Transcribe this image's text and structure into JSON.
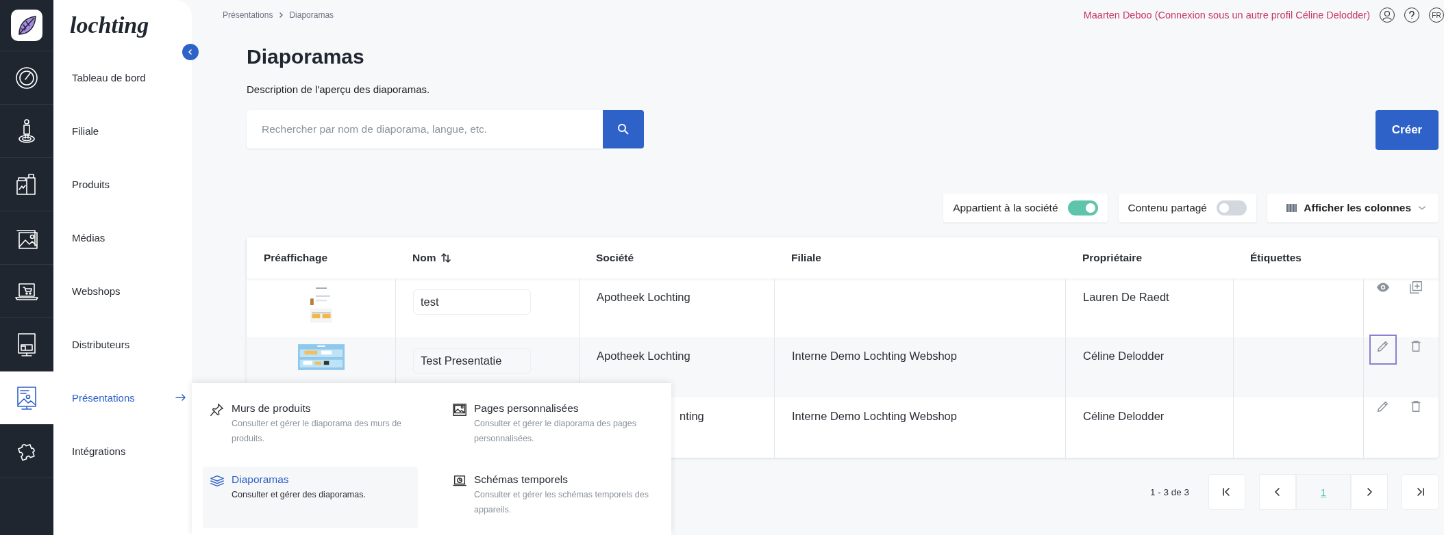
{
  "brand": {
    "wordmark": "lochting"
  },
  "sidebar": {
    "items": [
      {
        "label": "Tableau de bord",
        "selected": false
      },
      {
        "label": "Filiale",
        "selected": false
      },
      {
        "label": "Produits",
        "selected": false
      },
      {
        "label": "Médias",
        "selected": false
      },
      {
        "label": "Webshops",
        "selected": false
      },
      {
        "label": "Distributeurs",
        "selected": false
      },
      {
        "label": "Présentations",
        "selected": true
      },
      {
        "label": "Intégrations",
        "selected": false
      }
    ]
  },
  "breadcrumb": [
    "Présentations",
    "Diaporamas"
  ],
  "user": {
    "name": "Maarten Deboo (Connexion sous un autre profil Céline Delodder)",
    "language": "FR"
  },
  "page": {
    "title": "Diaporamas",
    "description": "Description de l'aperçu des diaporamas."
  },
  "search": {
    "placeholder": "Rechercher par nom de diaporama, langue, etc."
  },
  "create_button": "Créer",
  "filters": [
    {
      "label": "Appartient à la société",
      "on": true
    },
    {
      "label": "Contenu partagé",
      "on": false
    }
  ],
  "columns_button": "Afficher les colonnes",
  "table": {
    "columns": [
      "Préaffichage",
      "Nom",
      "Société",
      "Filiale",
      "Propriétaire",
      "Étiquettes"
    ],
    "rows": [
      {
        "kind": "portrait-preview",
        "name": "test",
        "company": "Apotheek Lochting",
        "owner": "Lauren De Raedt",
        "actions": [
          {
            "kind": "view",
            "focused": false
          },
          {
            "kind": "duplicate",
            "focused": false
          }
        ]
      },
      {
        "kind": "landscape-preview",
        "name": "Test Presentatie",
        "company": "Apotheek Lochting",
        "branch": "Interne Demo Lochting Webshop",
        "owner": "Céline Delodder",
        "actions": [
          {
            "kind": "edit",
            "focused": true
          },
          {
            "kind": "delete",
            "focused": false
          }
        ]
      },
      {
        "kind": "under-menu",
        "company": "nting",
        "branch": "Interne Demo Lochting Webshop",
        "owner": "Céline Delodder",
        "actions": [
          {
            "kind": "edit",
            "focused": false
          },
          {
            "kind": "delete",
            "focused": false
          }
        ]
      }
    ]
  },
  "pagination": {
    "range": "1 - 3 de 3",
    "page": "1"
  },
  "menu": {
    "items": [
      {
        "title": "Murs de produits",
        "description": "Consulter et gérer le diaporama des murs de produits.",
        "selected": false
      },
      {
        "title": "Pages personnalisées",
        "description": "Consulter et gérer le diaporama des pages personnalisées.",
        "selected": false
      },
      {
        "title": "Diaporamas",
        "description": "Consulter et gérer des diaporamas.",
        "selected": true
      },
      {
        "title": "Schémas temporels",
        "description": "Consulter et gérer les schémas temporels des appareils.",
        "selected": false
      }
    ]
  }
}
